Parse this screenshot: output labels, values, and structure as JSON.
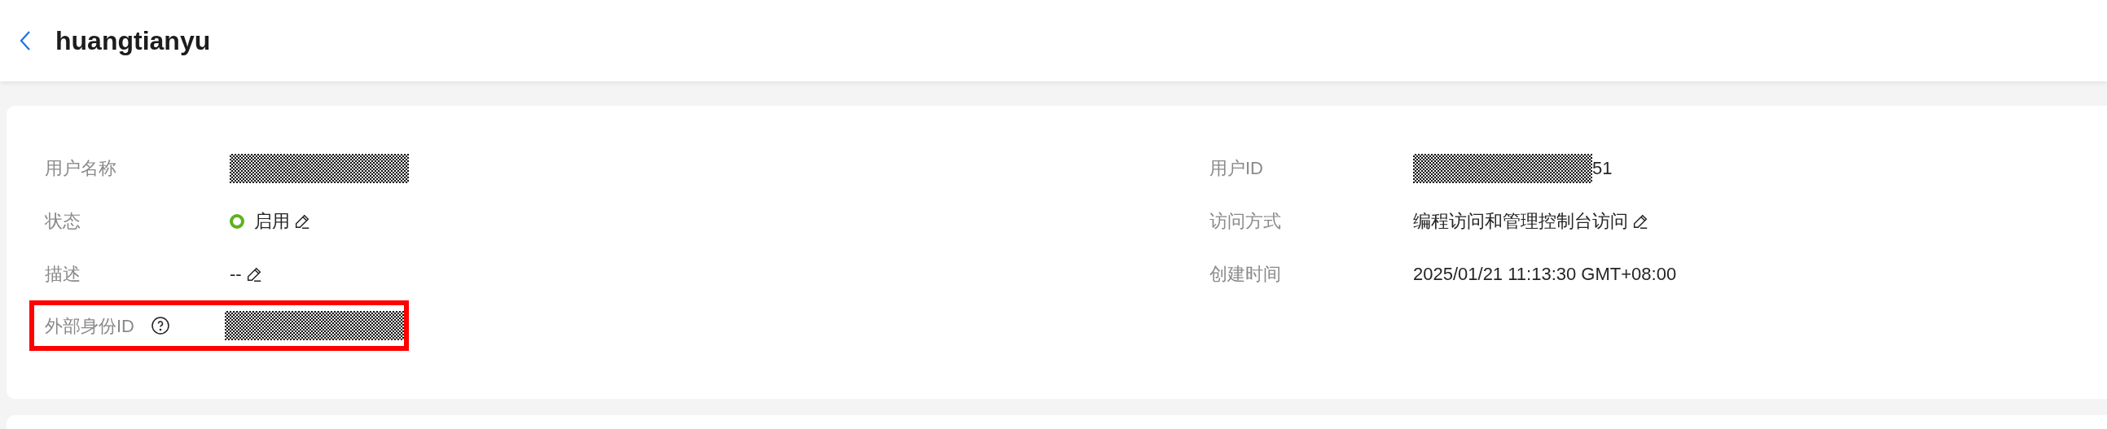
{
  "header": {
    "title": "huangtianyu"
  },
  "left_fields": [
    {
      "label": "用户名称",
      "kind": "redacted"
    },
    {
      "label": "状态",
      "kind": "status",
      "value": "启用",
      "color": "#5db21c",
      "editable": true
    },
    {
      "label": "描述",
      "kind": "text",
      "value": "--",
      "editable": true
    },
    {
      "label": "外部身份ID",
      "kind": "redacted",
      "help": true,
      "highlighted": true
    }
  ],
  "right_fields": [
    {
      "label": "用户ID",
      "kind": "redacted",
      "value": "51"
    },
    {
      "label": "访问方式",
      "kind": "text",
      "value": "编程访问和管理控制台访问",
      "editable": true
    },
    {
      "label": "创建时间",
      "kind": "text",
      "value": "2025/01/21 11:13:30 GMT+08:00"
    }
  ]
}
